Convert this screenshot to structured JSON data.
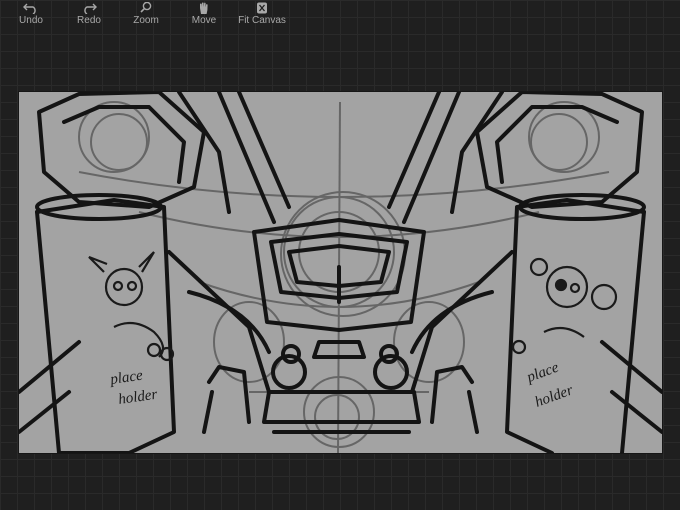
{
  "toolbar": {
    "undo": {
      "label": "Undo",
      "icon": "undo-arrow-icon"
    },
    "redo": {
      "label": "Redo",
      "icon": "redo-arrow-icon"
    },
    "zoom": {
      "label": "Zoom",
      "icon": "magnifier-icon"
    },
    "move": {
      "label": "Move",
      "icon": "hand-icon"
    },
    "fit_canvas": {
      "label": "Fit Canvas",
      "icon": "fit-canvas-icon"
    }
  },
  "canvas": {
    "background_color": "#a3a3a3",
    "ink_color": "#141414",
    "sketch_color": "#5c5c5c",
    "sketch_text_left": [
      "place",
      "holder"
    ],
    "sketch_text_right": [
      "place",
      "holder"
    ]
  },
  "workspace": {
    "background_color": "#1f1f1f",
    "grid_color": "#2a2a2a"
  }
}
